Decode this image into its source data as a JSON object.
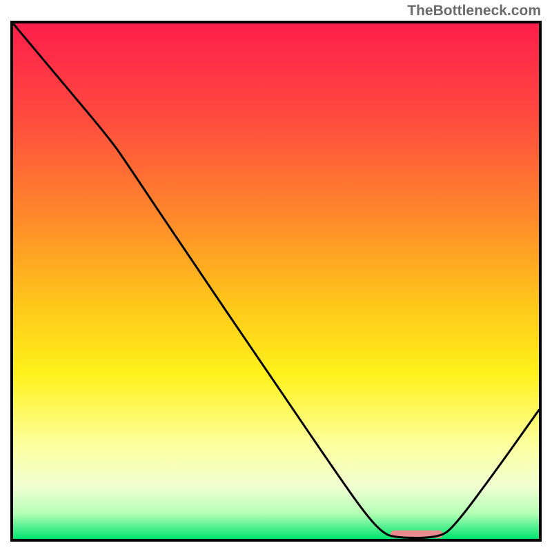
{
  "watermark": "TheBottleneck.com",
  "chart_data": {
    "type": "line",
    "title": "",
    "xlabel": "",
    "ylabel": "",
    "xlim": [
      0,
      100
    ],
    "ylim": [
      0,
      100
    ],
    "gradient_stops": [
      {
        "offset": 0,
        "color": "#ff1e4b"
      },
      {
        "offset": 18,
        "color": "#ff4a3f"
      },
      {
        "offset": 38,
        "color": "#ff8a2a"
      },
      {
        "offset": 55,
        "color": "#ffc919"
      },
      {
        "offset": 68,
        "color": "#fff11a"
      },
      {
        "offset": 82,
        "color": "#fcffa0"
      },
      {
        "offset": 90,
        "color": "#f0ffd2"
      },
      {
        "offset": 95,
        "color": "#b6ffb6"
      },
      {
        "offset": 100,
        "color": "#00e56f"
      }
    ],
    "series": [
      {
        "name": "bottleneck-curve",
        "color": "#000000",
        "points": [
          {
            "x": 0.0,
            "y": 100.0
          },
          {
            "x": 9.0,
            "y": 89.0
          },
          {
            "x": 18.5,
            "y": 77.5
          },
          {
            "x": 22.2,
            "y": 72.0
          },
          {
            "x": 33.0,
            "y": 55.5
          },
          {
            "x": 48.0,
            "y": 33.0
          },
          {
            "x": 60.0,
            "y": 15.0
          },
          {
            "x": 66.5,
            "y": 5.5
          },
          {
            "x": 70.0,
            "y": 1.4
          },
          {
            "x": 72.5,
            "y": 0.2
          },
          {
            "x": 81.0,
            "y": 0.2
          },
          {
            "x": 84.0,
            "y": 2.5
          },
          {
            "x": 92.0,
            "y": 13.5
          },
          {
            "x": 100.0,
            "y": 25.0
          }
        ]
      }
    ],
    "marker": {
      "name": "optimal-range",
      "color": "#e98b8f",
      "x_start": 72.5,
      "x_end": 81.0,
      "y": 0.9,
      "thickness": 1.5
    }
  }
}
